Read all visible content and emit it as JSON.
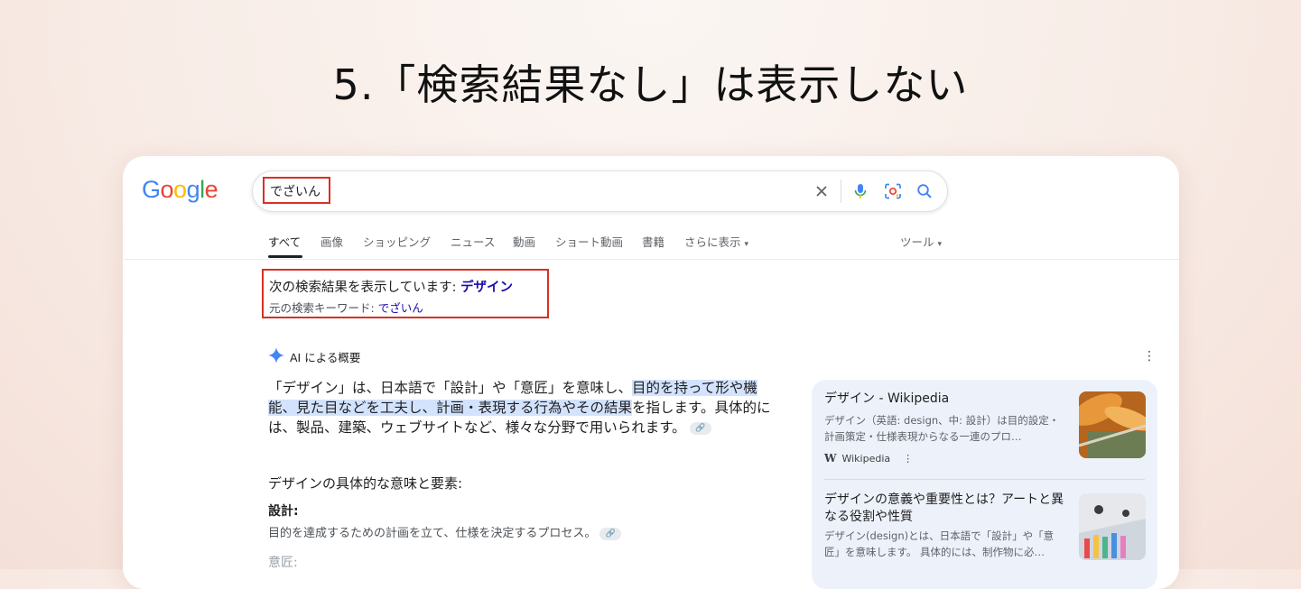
{
  "slide": {
    "title": "5.「検索結果なし」は表示しない"
  },
  "logo": {
    "text": "Google"
  },
  "search": {
    "query": "でざいん",
    "clear_icon": "close-icon",
    "voice_icon": "microphone-icon",
    "lens_icon": "camera-lens-icon",
    "search_icon": "search-icon"
  },
  "tabs": {
    "items": [
      "すべて",
      "画像",
      "ショッピング",
      "ニュース",
      "動画",
      "ショート動画",
      "書籍",
      "さらに表示"
    ],
    "tools": "ツール"
  },
  "correction": {
    "showing_prefix": "次の検索結果を表示しています:",
    "corrected_term": "デザイン",
    "original_prefix": "元の検索キーワード:",
    "original_term": "でざいん"
  },
  "ai_overview": {
    "label": "AI による概要",
    "para_start": "「デザイン」は、日本語で「設計」や「意匠」を意味し、",
    "para_highlight": "目的を持って形や機能、見た目などを工夫し、計画・表現する行為やその結果",
    "para_end": "を指します。具体的には、製品、建築、ウェブサイトなど、様々な分野で用いられます。",
    "sub_heading": "デザインの具体的な意味と要素:",
    "term1": "設計:",
    "term1_desc": "目的を達成するための計画を立て、仕様を決定するプロセス。",
    "term2": "意匠:"
  },
  "sources": [
    {
      "title": "デザイン - Wikipedia",
      "snippet": "デザイン（英語: design、中: 設計）は目的設定・計画策定・仕様表現からなる一連のプロ…",
      "site": "Wikipedia"
    },
    {
      "title": "デザインの意義や重要性とは？アートと異なる役割や性質",
      "snippet": "デザイン(design)とは、日本語で「設計」や「意匠」を意味します。 具体的には、制作物に必…"
    }
  ]
}
